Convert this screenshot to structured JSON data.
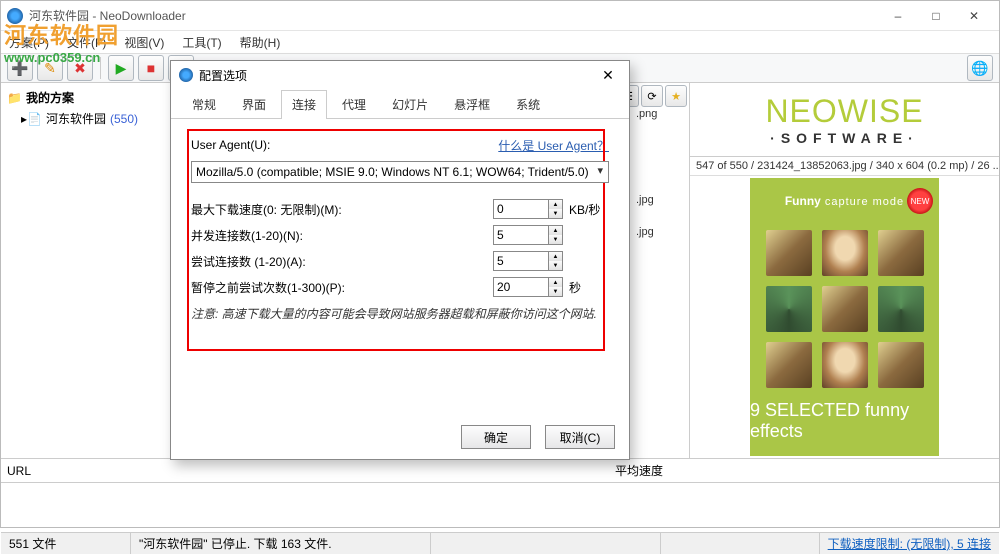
{
  "watermark": {
    "text": "河东软件园",
    "url": "www.pc0359.cn"
  },
  "window": {
    "title": "河东软件园 - NeoDownloader",
    "minimize": "–",
    "maximize": "□",
    "close": "✕"
  },
  "menu": {
    "file": "方案(P)",
    "edit": "文件(F)",
    "view": "视图(V)",
    "tools": "工具(T)",
    "help": "帮助(H)"
  },
  "sidebar": {
    "header": "我的方案",
    "project": "河东软件园",
    "count": "(550)"
  },
  "right": {
    "logo": "NEOWISE",
    "logo_sub": "·SOFTWARE·",
    "info": "547 of 550 / 231424_13852063.jpg / 340 x 604 (0.2 mp) / 26 ...",
    "preview": {
      "title_bold": "Funny",
      "title_rest": "  capture mode",
      "new": "NEW",
      "footer_big": "9",
      "footer_rest": " SELECTED funny effects"
    }
  },
  "column": {
    "url": "URL",
    "avg": "平均速度"
  },
  "visible_files": {
    "png": ".png",
    "jpg1": ".jpg",
    "jpg2": ".jpg"
  },
  "status": {
    "count": "551 文件",
    "message": "\"河东软件园\" 已停止. 下载 163 文件.",
    "limit": "下载速度限制: (无限制), 5 连接"
  },
  "dialog": {
    "title": "配置选项",
    "close": "✕",
    "tabs": [
      "常规",
      "界面",
      "连接",
      "代理",
      "幻灯片",
      "悬浮框",
      "系统"
    ],
    "active_tab": 2,
    "ua_label": "User Agent(U):",
    "ua_help": "什么是 User Agent？",
    "ua_value": "Mozilla/5.0 (compatible; MSIE 9.0; Windows NT 6.1; WOW64; Trident/5.0)",
    "max_speed_label": "最大下载速度(0: 无限制)(M):",
    "max_speed_value": "0",
    "max_speed_unit": "KB/秒",
    "conn_label": "并发连接数(1-20)(N):",
    "conn_value": "5",
    "retry_label": "尝试连接数 (1-20)(A):",
    "retry_value": "5",
    "pause_label": "暂停之前尝试次数(1-300)(P):",
    "pause_value": "20",
    "pause_unit": "秒",
    "note": "注意: 高速下载大量的内容可能会导致网站服务器超载和屏蔽你访问这个网站.",
    "ok": "确定",
    "cancel": "取消(C)"
  }
}
